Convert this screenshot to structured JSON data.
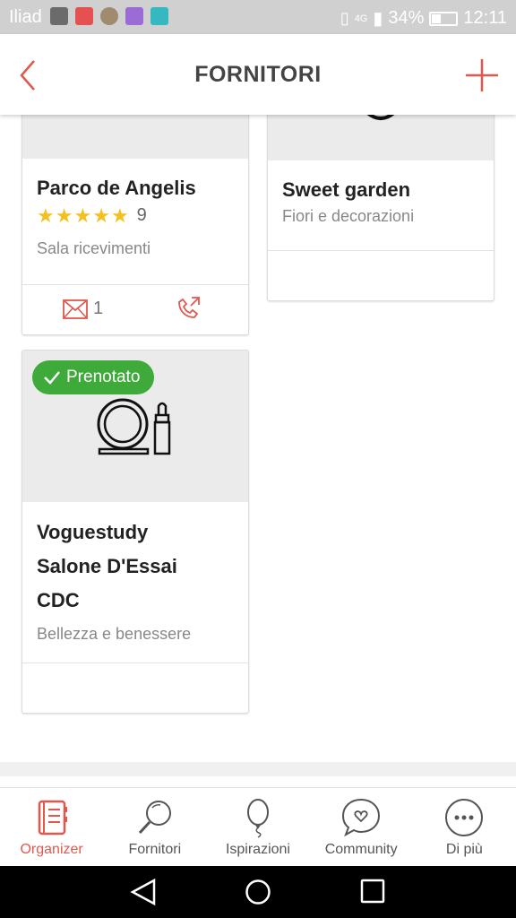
{
  "status_bar": {
    "carrier": "Iliad",
    "network": "4G",
    "battery": "34%",
    "time": "12:11"
  },
  "header": {
    "title": "FORNITORI"
  },
  "vendors": [
    {
      "name": "Parco de Angelis",
      "rating": "9",
      "stars": 5,
      "category": "Sala ricevimenti",
      "messages": "1"
    },
    {
      "name": "Sweet garden",
      "category": "Fiori e decorazioni"
    },
    {
      "badge": "Prenotato",
      "name": "Voguestudy Salone D'Essai CDC",
      "category": "Bellezza e benessere"
    }
  ],
  "nav": [
    {
      "label": "Organizer",
      "icon": "planner-icon",
      "active": true
    },
    {
      "label": "Fornitori",
      "icon": "search-icon"
    },
    {
      "label": "Ispirazioni",
      "icon": "balloon-icon"
    },
    {
      "label": "Community",
      "icon": "chat-heart-icon"
    },
    {
      "label": "Di più",
      "icon": "more-icon"
    }
  ],
  "colors": {
    "accent": "#e2574c",
    "booked": "#3daa39",
    "star": "#f3c021",
    "statusbar": "#d0d0d0"
  }
}
